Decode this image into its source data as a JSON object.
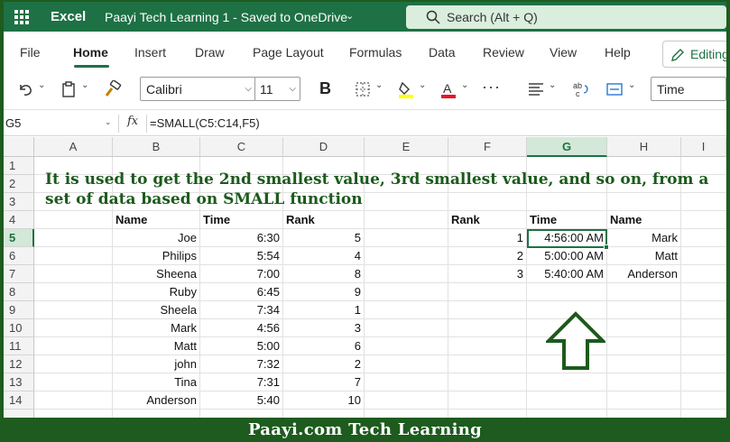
{
  "titlebar": {
    "app_name": "Excel",
    "doc_title": "Paayi Tech Learning 1  -  Saved to OneDrive",
    "search_placeholder": "Search (Alt + Q)"
  },
  "menu": {
    "tabs": [
      "File",
      "Home",
      "Insert",
      "Draw",
      "Page Layout",
      "Formulas",
      "Data",
      "Review",
      "View",
      "Help"
    ],
    "active_tab": "Home",
    "mode_button": "Editing"
  },
  "toolbar": {
    "font_name": "Calibri",
    "font_size": "11",
    "bold_label": "B",
    "number_format": "Time",
    "font_color": "#e81123",
    "highlight_color": "#ffff00",
    "icons": [
      "undo-icon",
      "paste-icon",
      "format-painter-icon",
      "borders-icon",
      "fill-color-icon",
      "font-color-icon",
      "more-icon",
      "align-icon",
      "wrap-text-icon",
      "merge-icon"
    ]
  },
  "formula_bar": {
    "name_box": "G5",
    "fx_label": "fx",
    "formula": "=SMALL(C5:C14,F5)"
  },
  "grid": {
    "columns": [
      "A",
      "B",
      "C",
      "D",
      "E",
      "F",
      "G",
      "H",
      "I"
    ],
    "selected_column": "G",
    "rows": [
      "1",
      "2",
      "3",
      "4",
      "5",
      "6",
      "7",
      "8",
      "9",
      "10",
      "11",
      "12",
      "13",
      "14",
      ""
    ],
    "selected_row": "5",
    "note": "It is used to get the 2nd smallest value, 3rd smallest value, and so on, from a set of data based on SMALL function",
    "table1": {
      "headers": [
        "Name",
        "Time",
        "Rank"
      ],
      "rows": [
        [
          "Joe",
          "6:30",
          "5"
        ],
        [
          "Philips",
          "5:54",
          "4"
        ],
        [
          "Sheena",
          "7:00",
          "8"
        ],
        [
          "Ruby",
          "6:45",
          "9"
        ],
        [
          "Sheela",
          "7:34",
          "1"
        ],
        [
          "Mark",
          "4:56",
          "3"
        ],
        [
          "Matt",
          "5:00",
          "6"
        ],
        [
          "john",
          "7:32",
          "2"
        ],
        [
          "Tina",
          "7:31",
          "7"
        ],
        [
          "Anderson",
          "5:40",
          "10"
        ]
      ]
    },
    "table2": {
      "headers": [
        "Rank",
        "Time",
        "Name"
      ],
      "rows": [
        [
          "1",
          "4:56:00 AM",
          "Mark"
        ],
        [
          "2",
          "5:00:00 AM",
          "Matt"
        ],
        [
          "3",
          "5:40:00 AM",
          "Anderson"
        ]
      ]
    }
  },
  "footer": {
    "text": "Paayi.com Tech Learning"
  },
  "colors": {
    "brand_green": "#1e7145",
    "frame_green": "#1e5b1e",
    "note_green": "#1c5a1c"
  }
}
